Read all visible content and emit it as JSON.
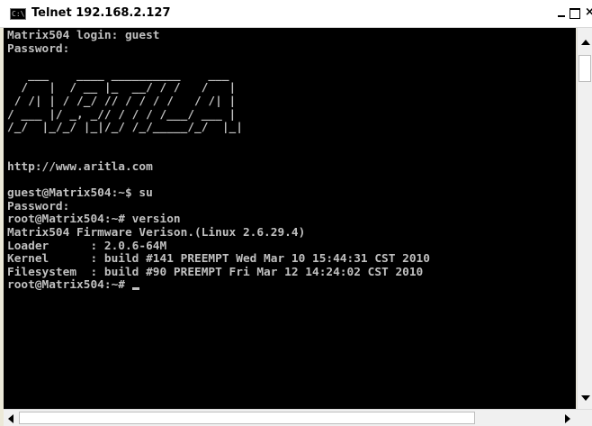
{
  "window": {
    "title": "Telnet 192.168.2.127",
    "icon": "console-icon",
    "icon_text": "C:\\",
    "controls": [
      "minimize-icon",
      "maximize-icon",
      "close-icon"
    ]
  },
  "terminal": {
    "background": "#000000",
    "foreground": "#c0c0c0",
    "lines": [
      "Matrix504 login: guest",
      "Password:",
      "",
      "   ___    ____ __________    ___",
      "  /   |  / __ |_  __/ / /   /   |",
      " / /| | / /_/ // / / / /   / /| |",
      "/ ___ |/ _, _// / / / /___/ ___ |",
      "/_/  |_/_/ |_|/_/ /_/_____/_/  |_|",
      "",
      "",
      "http://www.aritla.com",
      "",
      "guest@Matrix504:~$ su",
      "Password:",
      "root@Matrix504:~# version",
      "Matrix504 Firmware Verison.(Linux 2.6.29.4)",
      "Loader      : 2.0.6-64M",
      "Kernel      : build #141 PREEMPT Wed Mar 10 15:44:31 CST 2010",
      "Filesystem  : build #90 PREEMPT Fri Mar 12 14:24:02 CST 2010"
    ],
    "prompt": "root@Matrix504:~# "
  },
  "scrollbars": {
    "vertical": [
      "scroll-up-icon",
      "scroll-down-icon"
    ],
    "horizontal": [
      "scroll-left-icon",
      "scroll-right-icon"
    ]
  }
}
